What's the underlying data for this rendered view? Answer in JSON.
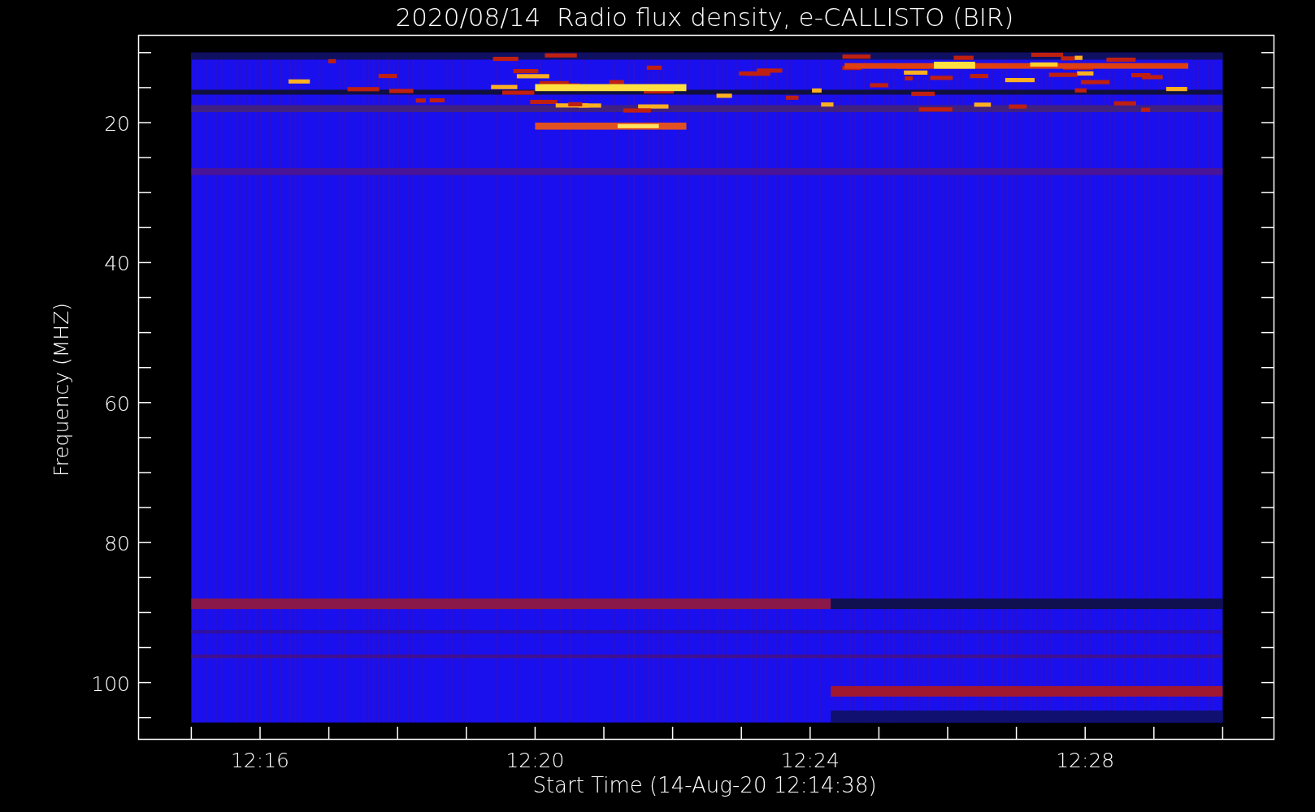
{
  "title": "2020/08/14  Radio flux density, e-CALLISTO (BIR)",
  "ylabel": "Frequency (MHZ)",
  "xlabel": "Start Time (14-Aug-20 12:14:38)",
  "yticks": [
    "20",
    "40",
    "60",
    "80",
    "100"
  ],
  "xticks": [
    "12:16",
    "12:20",
    "12:24",
    "12:28"
  ]
}
